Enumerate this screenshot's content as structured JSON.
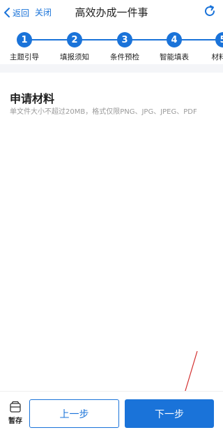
{
  "nav": {
    "back_label": "返回",
    "close_label": "关闭",
    "title": "高效办成一件事"
  },
  "steps": [
    {
      "number": "1",
      "label": "主题引导"
    },
    {
      "number": "2",
      "label": "填报须知"
    },
    {
      "number": "3",
      "label": "条件预检"
    },
    {
      "number": "4",
      "label": "智能填表"
    },
    {
      "number": "5",
      "label": "材料"
    }
  ],
  "section": {
    "title": "申请材料",
    "hint": "单文件大小不超过20MB，格式仅限PNG、JPG、JPEG、PDF"
  },
  "bottom": {
    "save_label": "暂存",
    "prev_label": "上一步",
    "next_label": "下一步"
  },
  "colors": {
    "accent": "#1a73d9",
    "annotation_arrow": "#d32f2f"
  }
}
